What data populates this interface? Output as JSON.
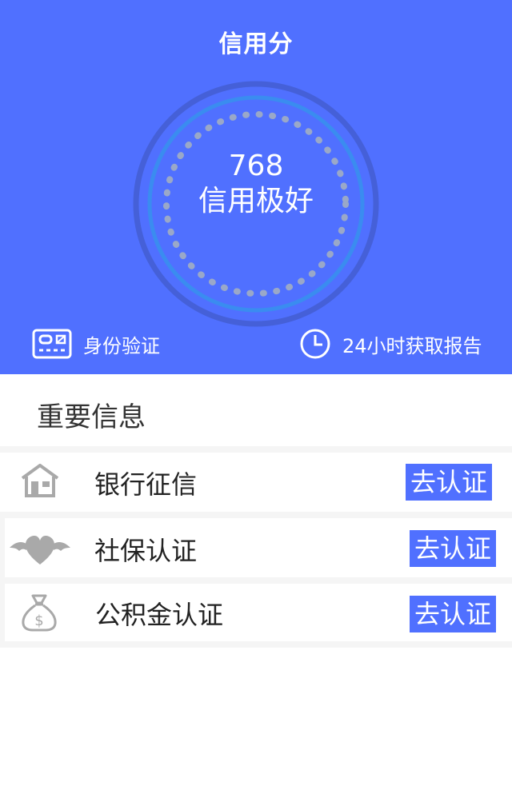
{
  "header": {
    "title": "信用分"
  },
  "score": {
    "value": "768",
    "level": "信用极好"
  },
  "features": {
    "id_verify": "身份验证",
    "report": "24小时获取报告"
  },
  "section": {
    "title": "重要信息"
  },
  "items": [
    {
      "label": "银行征信",
      "action": "去认证",
      "icon": "bank-house-icon"
    },
    {
      "label": "社保认证",
      "action": "去认证",
      "icon": "winged-heart-icon"
    },
    {
      "label": "公积金认证",
      "action": "去认证",
      "icon": "money-bag-icon"
    }
  ],
  "colors": {
    "accent": "#5070ff",
    "gauge_outer": "#4560d8",
    "gauge_ring": "#3a8cf0",
    "gauge_dots": "#9aa8c8",
    "icon_gray": "#a9a9a9"
  }
}
